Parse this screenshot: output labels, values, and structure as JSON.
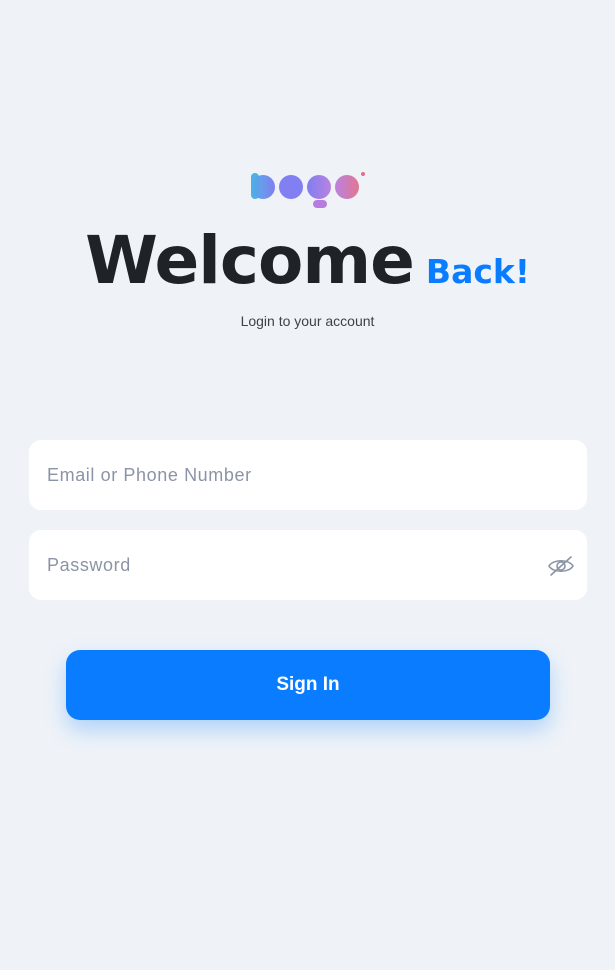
{
  "logo": {
    "alt_text": "Logo",
    "colors": [
      "#4fb0e6",
      "#7a78f0",
      "#b77ce0",
      "#e0708c"
    ]
  },
  "header": {
    "title_main": "Welcome",
    "title_accent": "Back!",
    "subtitle": "Login to your account"
  },
  "form": {
    "email_placeholder": "Email or Phone Number",
    "email_value": "",
    "password_placeholder": "Password",
    "password_value": "",
    "password_toggle_icon": "eye-off-icon",
    "submit_label": "Sign In"
  },
  "colors": {
    "background": "#eff3f8",
    "accent": "#0a7cff",
    "text_dark": "#1f2226",
    "placeholder": "#8b93a6"
  }
}
